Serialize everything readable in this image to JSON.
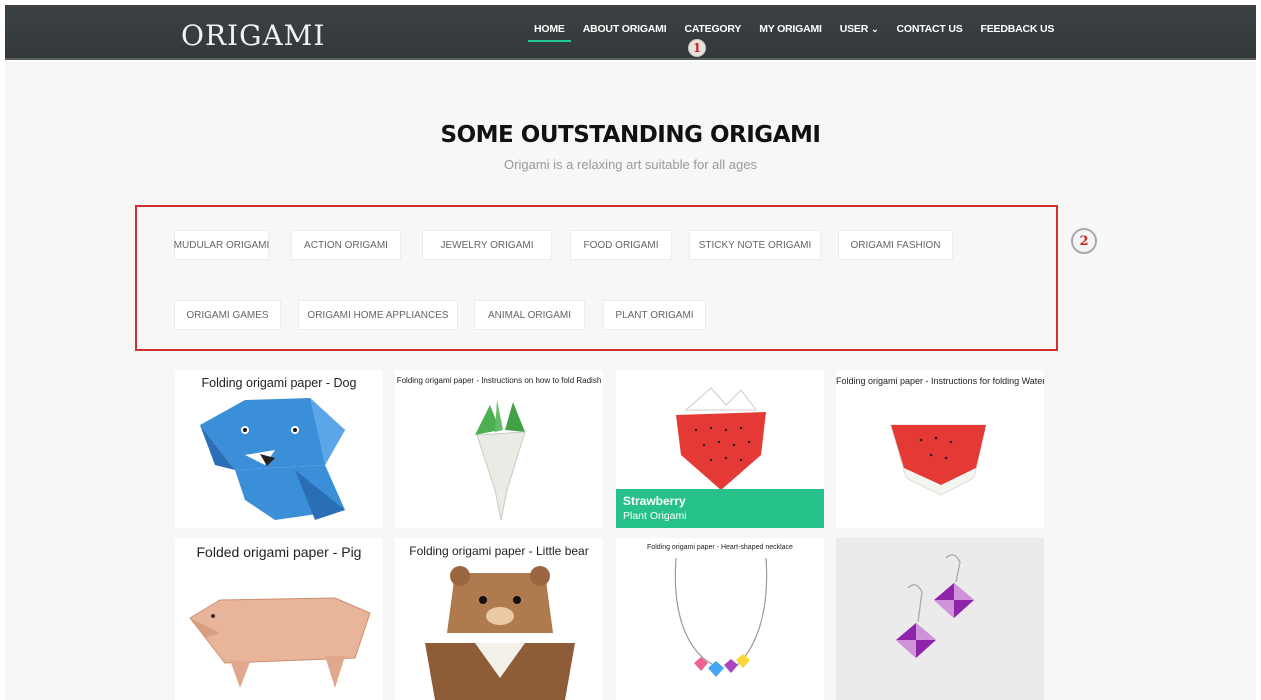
{
  "brand": "ORIGAMI",
  "nav": {
    "items": [
      {
        "label": "HOME",
        "active": true
      },
      {
        "label": "ABOUT ORIGAMI"
      },
      {
        "label": "CATEGORY"
      },
      {
        "label": "MY ORIGAMI"
      },
      {
        "label": "USER",
        "dropdown": true
      },
      {
        "label": "CONTACT US"
      },
      {
        "label": "FEEDBACK US"
      }
    ]
  },
  "markers": [
    "1",
    "2"
  ],
  "section": {
    "title": "SOME OUTSTANDING ORIGAMI",
    "subtitle": "Origami is a relaxing art suitable for all ages"
  },
  "categories": [
    "MUDULAR ORIGAMI",
    "ACTION ORIGAMI",
    "JEWELRY ORIGAMI",
    "FOOD ORIGAMI",
    "STICKY NOTE ORIGAMI",
    "ORIGAMI FASHION",
    "ORIGAMI GAMES",
    "ORIGAMI HOME APPLIANCES",
    "ANIMAL ORIGAMI",
    "PLANT ORIGAMI"
  ],
  "cards": [
    {
      "caption": "Folding origami paper - Dog"
    },
    {
      "caption": "Folding origami paper - Instructions on how to fold Radish"
    },
    {
      "caption": "",
      "overlay_title": "Strawberry",
      "overlay_sub": "Plant Origami"
    },
    {
      "caption": "Folding origami paper - Instructions for folding Watermelon"
    },
    {
      "caption": "Folded origami paper - Pig"
    },
    {
      "caption": "Folding origami paper - Little bear"
    },
    {
      "caption": "Folding origami paper - Heart-shaped necklace"
    },
    {
      "caption": ""
    }
  ],
  "colors": {
    "accent": "#20c997",
    "badge": "#27c28a",
    "highlight_border": "#d32f2f",
    "navbar": "#373c3f"
  }
}
